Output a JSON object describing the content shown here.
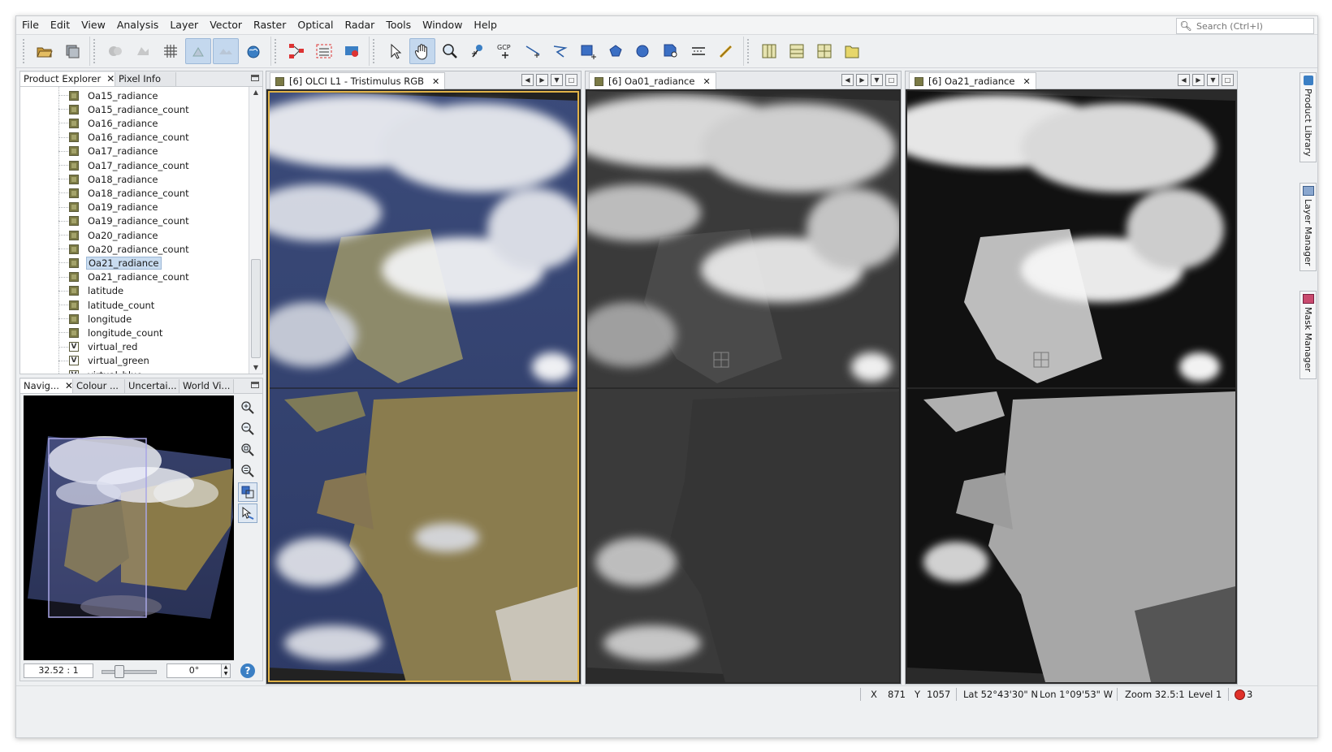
{
  "menu": [
    "File",
    "Edit",
    "View",
    "Analysis",
    "Layer",
    "Vector",
    "Raster",
    "Optical",
    "Radar",
    "Tools",
    "Window",
    "Help"
  ],
  "search": {
    "placeholder": "Search (Ctrl+I)"
  },
  "toolbar_icons": [
    "open-product-icon",
    "save-product-icon",
    "band-maths-icon",
    "export-icon",
    "graticule-icon",
    "pin-icon",
    "gcp-icon",
    "world-view-icon",
    "graph-builder-icon",
    "batch-icon",
    "product-grabber-icon",
    "select-tool-icon",
    "pan-tool-icon",
    "zoom-tool-icon",
    "pin-placing-icon",
    "gcp-placing-icon",
    "line-drawing-icon",
    "polyline-drawing-icon",
    "rectangle-drawing-icon",
    "polygon-drawing-icon",
    "ellipse-drawing-icon",
    "magic-wand-icon",
    "range-finder-icon",
    "measure-icon",
    "tile-horizontal-icon",
    "tile-vertical-icon",
    "tile-grid-icon",
    "tile-single-icon"
  ],
  "gcp_label": "GCP",
  "product_explorer": {
    "tabs": [
      "Product Explorer",
      "Pixel Info"
    ],
    "items": [
      {
        "label": "Oa15_radiance",
        "type": "band"
      },
      {
        "label": "Oa15_radiance_count",
        "type": "band"
      },
      {
        "label": "Oa16_radiance",
        "type": "band"
      },
      {
        "label": "Oa16_radiance_count",
        "type": "band"
      },
      {
        "label": "Oa17_radiance",
        "type": "band"
      },
      {
        "label": "Oa17_radiance_count",
        "type": "band"
      },
      {
        "label": "Oa18_radiance",
        "type": "band"
      },
      {
        "label": "Oa18_radiance_count",
        "type": "band"
      },
      {
        "label": "Oa19_radiance",
        "type": "band"
      },
      {
        "label": "Oa19_radiance_count",
        "type": "band"
      },
      {
        "label": "Oa20_radiance",
        "type": "band"
      },
      {
        "label": "Oa20_radiance_count",
        "type": "band"
      },
      {
        "label": "Oa21_radiance",
        "type": "band",
        "selected": true
      },
      {
        "label": "Oa21_radiance_count",
        "type": "band"
      },
      {
        "label": "latitude",
        "type": "band"
      },
      {
        "label": "latitude_count",
        "type": "band"
      },
      {
        "label": "longitude",
        "type": "band"
      },
      {
        "label": "longitude_count",
        "type": "band"
      },
      {
        "label": "virtual_red",
        "type": "virtual"
      },
      {
        "label": "virtual_green",
        "type": "virtual"
      },
      {
        "label": "virtual_blue",
        "type": "virtual"
      }
    ]
  },
  "bottom_panel": {
    "tabs": [
      "Navig...",
      "Colour ...",
      "Uncertai...",
      "World Vi..."
    ],
    "zoom_factor": "32.52 : 1",
    "rotation": "0°",
    "help": "?"
  },
  "views": [
    {
      "title": "[6] OLCI L1 - Tristimulus RGB",
      "selected": true,
      "style": "rgb"
    },
    {
      "title": "[6] Oa01_radiance",
      "selected": false,
      "style": "gray-dark"
    },
    {
      "title": "[6] Oa21_radiance",
      "selected": false,
      "style": "gray-bright"
    }
  ],
  "side_tools": [
    "Product Library",
    "Layer Manager",
    "Mask Manager"
  ],
  "status": {
    "x_label": "X",
    "x_value": "871",
    "y_label": "Y",
    "y_value": "1057",
    "lat": "Lat 52°43'30\" N",
    "lon": "Lon 1°09'53\" W",
    "zoom": "Zoom 32.5:1",
    "level": "Level 1",
    "errors": "3"
  },
  "colors": {
    "accent_select": "#c9dcf0",
    "view_selected_border": "#e0b247",
    "error_badge": "#e0312a"
  }
}
